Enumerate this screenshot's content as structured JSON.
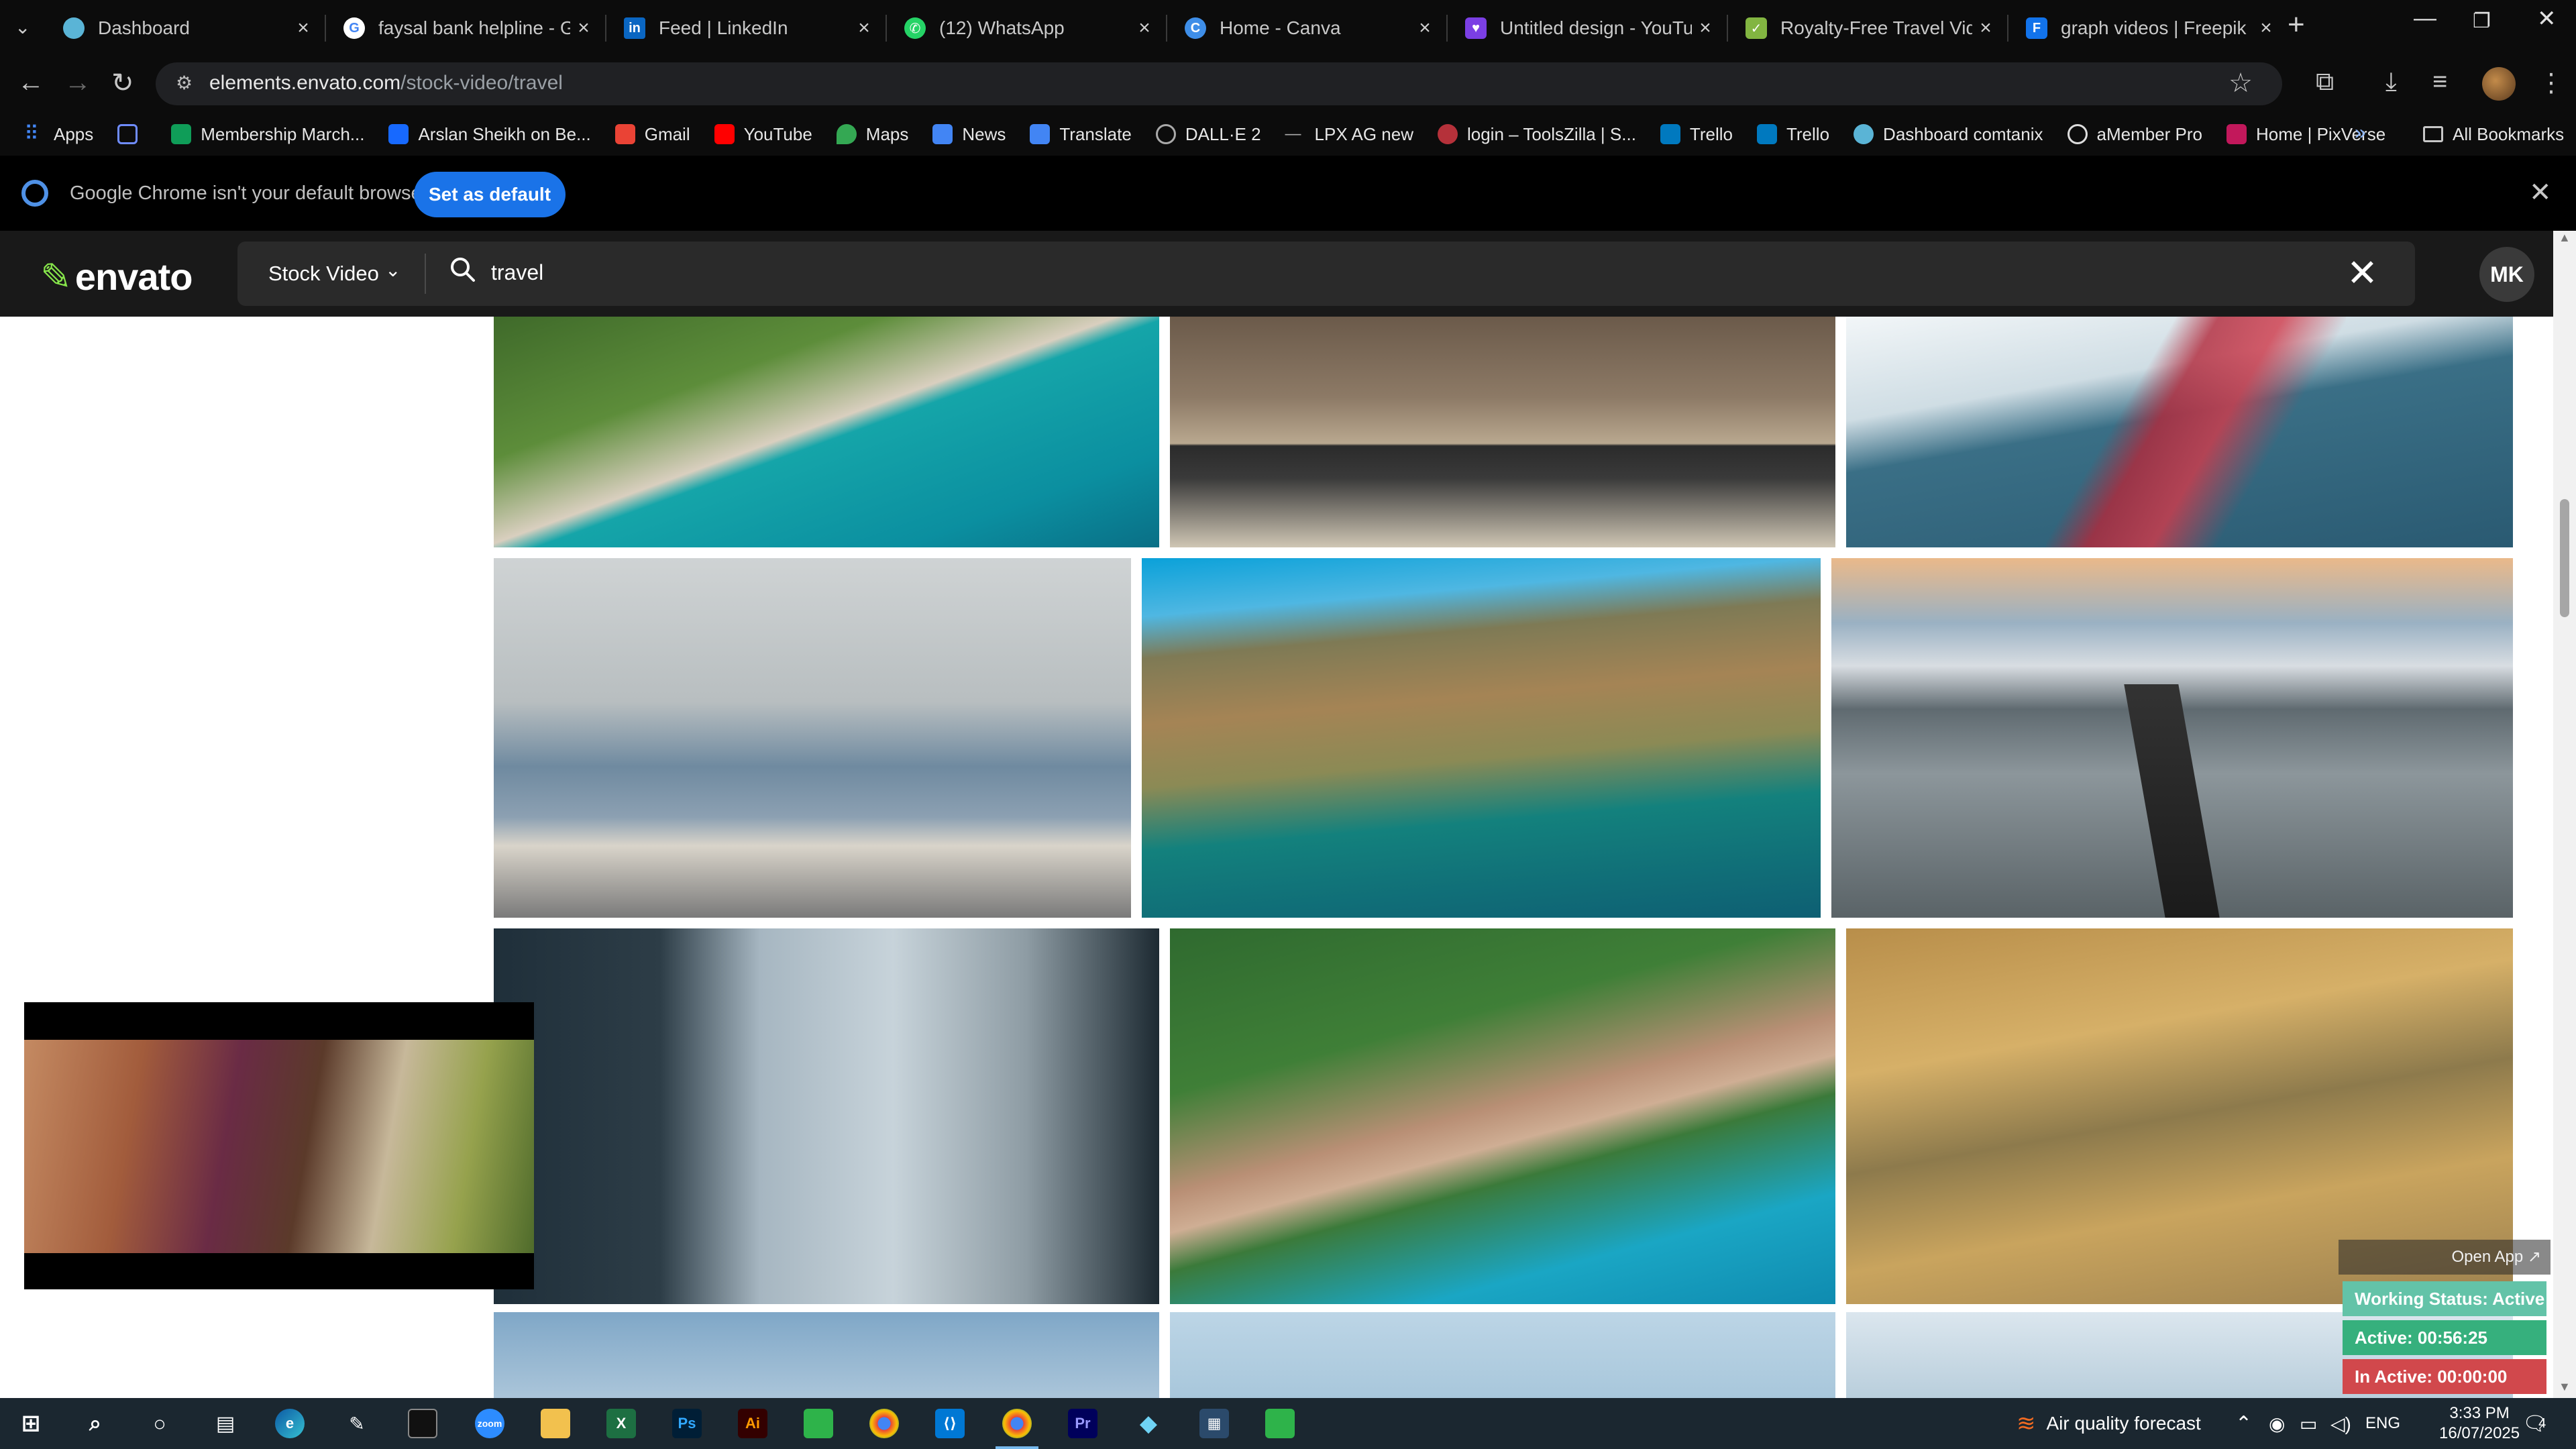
{
  "browser": {
    "tabs": [
      {
        "title": "Dashboard",
        "icon": "dashboard-favicon",
        "color": "#5ab4d6"
      },
      {
        "title": "faysal bank helpline - Goo",
        "icon": "google-favicon",
        "color": "#4285f4"
      },
      {
        "title": "Feed | LinkedIn",
        "icon": "linkedin-favicon",
        "color": "#0a66c2"
      },
      {
        "title": "(12) WhatsApp",
        "icon": "whatsapp-favicon",
        "color": "#25d366"
      },
      {
        "title": "Home - Canva",
        "icon": "canva-favicon",
        "color": "#3e8ee8"
      },
      {
        "title": "Untitled design - YouTube",
        "icon": "canva-youtube-favicon",
        "color": "#7b3fe4"
      },
      {
        "title": "Royalty-Free Travel Video",
        "icon": "envato-favicon",
        "color": "#82b541"
      },
      {
        "title": "graph videos | Freepik",
        "icon": "freepik-favicon",
        "color": "#1273eb"
      }
    ],
    "new_tab_label": "+",
    "url_host": "elements.envato.com",
    "url_path": "/stock-video/travel",
    "bookmarks": [
      {
        "label": "Apps",
        "color": "#4285f4"
      },
      {
        "label": "",
        "color": "#6f8cff"
      },
      {
        "label": "Membership March...",
        "color": "#0f9d58"
      },
      {
        "label": "Arslan Sheikh on Be...",
        "color": "#1769ff"
      },
      {
        "label": "Gmail",
        "color": "#ea4335"
      },
      {
        "label": "YouTube",
        "color": "#ff0000"
      },
      {
        "label": "Maps",
        "color": "#34a853"
      },
      {
        "label": "News",
        "color": "#4285f4"
      },
      {
        "label": "Translate",
        "color": "#4285f4"
      },
      {
        "label": "DALL·E 2",
        "color": "#888888"
      },
      {
        "label": "LPX AG new",
        "color": "#555555"
      },
      {
        "label": "login – ToolsZilla | S...",
        "color": "#b5313a"
      },
      {
        "label": "Trello",
        "color": "#0079bf"
      },
      {
        "label": "Trello",
        "color": "#0079bf"
      },
      {
        "label": "Dashboard comtanix",
        "color": "#5ab4d6"
      },
      {
        "label": "aMember Pro",
        "color": "#dddddd"
      },
      {
        "label": "Home | PixVerse",
        "color": "#c2185b"
      }
    ],
    "bookmarks_more": "»",
    "all_bookmarks": "All Bookmarks",
    "infobar": {
      "message": "Google Chrome isn't your default browser",
      "button": "Set as default"
    }
  },
  "envato": {
    "logo": "envato",
    "category": "Stock Video",
    "query": "travel",
    "user_initials": "MK"
  },
  "grid": {
    "clips": [
      {
        "name": "cliff-beach-aerial",
        "scene": "t-cliff"
      },
      {
        "name": "couple-laptop-sofa",
        "scene": "t-couple"
      },
      {
        "name": "icebreaker-ship",
        "scene": "t-ice"
      },
      {
        "name": "family-sofa-suitcases",
        "scene": "t-family"
      },
      {
        "name": "coastal-highway-bridge",
        "scene": "t-coast"
      },
      {
        "name": "snowy-road-aerial",
        "scene": "t-road"
      },
      {
        "name": "man-train-window",
        "scene": "t-train"
      },
      {
        "name": "coastal-village-aerial",
        "scene": "t-village"
      },
      {
        "name": "desert-hills-road",
        "scene": "t-desert"
      },
      {
        "name": "sky-clip-1",
        "scene": "t-sky1"
      },
      {
        "name": "sky-clip-2",
        "scene": "t-sky2"
      },
      {
        "name": "sky-clip-3",
        "scene": "t-sky3"
      }
    ]
  },
  "tracker": {
    "open_app": "Open App ↗",
    "working_status": "Working Status: Active",
    "active": "Active: 00:56:25",
    "inactive": "In Active: 00:00:00"
  },
  "taskbar": {
    "weather": "Air quality forecast",
    "language": "ENG",
    "time": "3:33 PM",
    "date": "16/07/2025",
    "notification_count": "4"
  }
}
